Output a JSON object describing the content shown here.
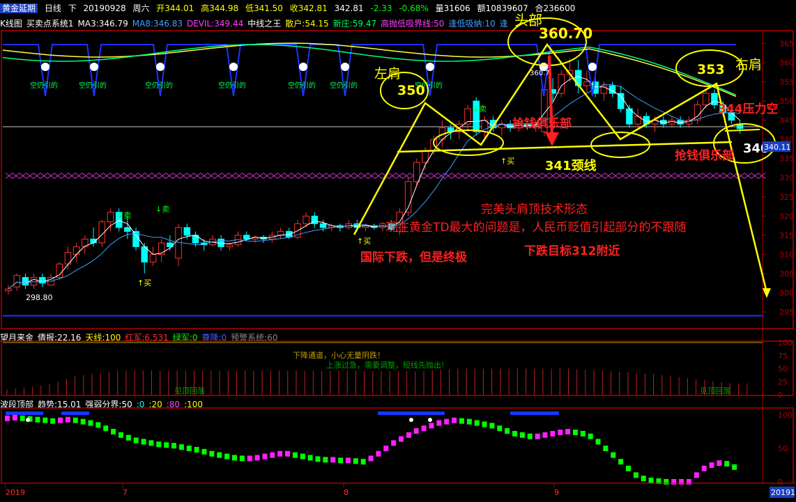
{
  "header": {
    "symbol": "黄金延期",
    "period": "日线",
    "flag": "下",
    "date": "20190928",
    "weekday": "周六",
    "open": "开344.01",
    "high": "高344.98",
    "low": "低341.50",
    "close": "收342.81",
    "last": "342.81",
    "change": "-2.33",
    "change_pct": "-0.68%",
    "volume": "量31606",
    "amount": "额10839607",
    "open_interest": "合236600"
  },
  "indicators_main": [
    {
      "text": "K线图",
      "color": "#ffffff"
    },
    {
      "text": "买卖点系统1",
      "color": "#ffffff"
    },
    {
      "text": "MA3:346.79",
      "color": "#ffffff"
    },
    {
      "text": "MA8:346.83",
      "color": "#3ea0ff"
    },
    {
      "text": "DEVIL:349.44",
      "color": "#ff40ff"
    },
    {
      "text": "中线之王",
      "color": "#ffffff"
    },
    {
      "text": "散户:54.15",
      "color": "#ffff00"
    },
    {
      "text": "新庄:59.47",
      "color": "#00ff60"
    },
    {
      "text": "高抛低吸界线:50",
      "color": "#ff40ff"
    },
    {
      "text": "逢低吸纳:10",
      "color": "#40a0ff"
    },
    {
      "text": "逢",
      "color": "#40a0ff"
    }
  ],
  "indicators_p2": [
    {
      "text": "望月来金",
      "color": "#ffffff"
    },
    {
      "text": "倩报:22.16",
      "color": "#ffffff"
    },
    {
      "text": "天线:100",
      "color": "#ffff00"
    },
    {
      "text": "红军:6.531",
      "color": "#ff3030"
    },
    {
      "text": "绿军:0",
      "color": "#00ff00"
    },
    {
      "text": "尊降:0",
      "color": "#4060ff"
    },
    {
      "text": "预警系统:60",
      "color": "#888888"
    }
  ],
  "indicators_p3": [
    {
      "text": "波段顶部",
      "color": "#ffffff"
    },
    {
      "text": "趋势:15.01",
      "color": "#ffffff"
    },
    {
      "text": "强弱分界:50",
      "color": "#ffffff"
    },
    {
      "text": ":0",
      "color": "#00ffff"
    },
    {
      "text": ":20",
      "color": "#ffff00"
    },
    {
      "text": ":80",
      "color": "#ff40ff"
    },
    {
      "text": ":100",
      "color": "#ffff00"
    }
  ],
  "annotations": {
    "head": "头部",
    "head_value": "360.70",
    "left_shoulder": "左肩",
    "left_value": "350",
    "right_shoulder": "右肩",
    "right_value": "353",
    "neckline": "341颈线",
    "pattern": "完美头肩顶技术形态",
    "problem": "现在黄金TD最大的问题是，人民币贬值引起部分的不跟随",
    "intl": "国际下跌，但是终极",
    "target": "下跌目标312附近",
    "pressure": "344压力空",
    "club1": "抢钱俱乐部",
    "club2": "抢钱俱乐部",
    "v340": "340",
    "v298": "298.80",
    "v360_small": "360.7",
    "buy": "↑买",
    "sell": "↓卖",
    "empty": "空仍引的",
    "p2_down": "下降通道，小心无量阴跌！",
    "p2_mid": "上涨过急，需要调整，短线先抛出!",
    "p2_peak": "见顶回落"
  },
  "price_tag": "340.11",
  "colors": {
    "up": "#ff3030",
    "down": "#00ffff",
    "ma3": "#ffffff",
    "ma8": "#3ea0ff",
    "annotation_yellow": "#ffff00",
    "annotation_red": "#ff2020",
    "blue_band": "#1a35ff"
  },
  "chart_data": [
    {
      "type": "candlestick",
      "y_axis_ticks": [
        295,
        300,
        305,
        310,
        315,
        320,
        325,
        330,
        335,
        340,
        345,
        350,
        355,
        360,
        365
      ],
      "ylim": [
        291,
        368
      ],
      "x_ticks": [
        "2019",
        "7",
        "8",
        "9",
        "20191"
      ],
      "candles": [
        {
          "o": 300.5,
          "h": 302,
          "l": 299.5,
          "c": 301
        },
        {
          "o": 301.5,
          "h": 305,
          "l": 300.5,
          "c": 304.5
        },
        {
          "o": 304,
          "h": 305,
          "l": 301,
          "c": 302
        },
        {
          "o": 302,
          "h": 305,
          "l": 301,
          "c": 304
        },
        {
          "o": 304,
          "h": 305,
          "l": 301.5,
          "c": 302.5
        },
        {
          "o": 302,
          "h": 305,
          "l": 302,
          "c": 304
        },
        {
          "o": 304,
          "h": 308,
          "l": 303.5,
          "c": 307.5
        },
        {
          "o": 307.5,
          "h": 312,
          "l": 306,
          "c": 310.5
        },
        {
          "o": 310,
          "h": 313,
          "l": 308,
          "c": 312
        },
        {
          "o": 312,
          "h": 315,
          "l": 310,
          "c": 314
        },
        {
          "o": 314,
          "h": 317,
          "l": 312,
          "c": 313
        },
        {
          "o": 313,
          "h": 319,
          "l": 312,
          "c": 318.5
        },
        {
          "o": 318.5,
          "h": 322,
          "l": 316,
          "c": 321
        },
        {
          "o": 321,
          "h": 322,
          "l": 316,
          "c": 317
        },
        {
          "o": 317,
          "h": 320,
          "l": 314,
          "c": 316
        },
        {
          "o": 316,
          "h": 317,
          "l": 311,
          "c": 312
        },
        {
          "o": 312,
          "h": 313,
          "l": 305,
          "c": 308
        },
        {
          "o": 308,
          "h": 312,
          "l": 307,
          "c": 310
        },
        {
          "o": 310,
          "h": 314,
          "l": 308,
          "c": 313
        },
        {
          "o": 313,
          "h": 315,
          "l": 311,
          "c": 312
        },
        {
          "o": 309,
          "h": 318,
          "l": 307,
          "c": 317
        },
        {
          "o": 317,
          "h": 318,
          "l": 314,
          "c": 315
        },
        {
          "o": 315,
          "h": 316,
          "l": 312,
          "c": 313
        },
        {
          "o": 313,
          "h": 314,
          "l": 311,
          "c": 312.5
        },
        {
          "o": 312.5,
          "h": 315,
          "l": 312,
          "c": 314
        },
        {
          "o": 314,
          "h": 315,
          "l": 311,
          "c": 312
        },
        {
          "o": 312,
          "h": 313,
          "l": 311,
          "c": 312.5
        },
        {
          "o": 312.5,
          "h": 316,
          "l": 312,
          "c": 315
        },
        {
          "o": 315,
          "h": 316,
          "l": 313.5,
          "c": 314
        },
        {
          "o": 314,
          "h": 315,
          "l": 313,
          "c": 314.5
        },
        {
          "o": 314.5,
          "h": 315,
          "l": 313,
          "c": 314
        },
        {
          "o": 314,
          "h": 316,
          "l": 313,
          "c": 315
        },
        {
          "o": 315,
          "h": 317,
          "l": 314,
          "c": 316
        },
        {
          "o": 316,
          "h": 317,
          "l": 314,
          "c": 314.5
        },
        {
          "o": 314.5,
          "h": 319,
          "l": 314,
          "c": 318
        },
        {
          "o": 318,
          "h": 321,
          "l": 317,
          "c": 320
        },
        {
          "o": 320,
          "h": 321,
          "l": 317,
          "c": 318
        },
        {
          "o": 318,
          "h": 319,
          "l": 316,
          "c": 317
        },
        {
          "o": 317,
          "h": 318,
          "l": 316,
          "c": 317.5
        },
        {
          "o": 317.5,
          "h": 318,
          "l": 316,
          "c": 317
        },
        {
          "o": 317,
          "h": 319,
          "l": 316.5,
          "c": 318
        },
        {
          "o": 318,
          "h": 319,
          "l": 316,
          "c": 317
        },
        {
          "o": 317,
          "h": 318,
          "l": 316,
          "c": 317.5
        },
        {
          "o": 317.5,
          "h": 318,
          "l": 316.5,
          "c": 317
        },
        {
          "o": 317,
          "h": 318.5,
          "l": 316,
          "c": 318
        },
        {
          "o": 318,
          "h": 319,
          "l": 316,
          "c": 316.5
        },
        {
          "o": 316,
          "h": 322,
          "l": 315,
          "c": 321
        },
        {
          "o": 321,
          "h": 330,
          "l": 320,
          "c": 329
        },
        {
          "o": 329,
          "h": 335,
          "l": 328,
          "c": 334
        },
        {
          "o": 334,
          "h": 338,
          "l": 332,
          "c": 337
        },
        {
          "o": 337,
          "h": 341,
          "l": 336,
          "c": 340
        },
        {
          "o": 340,
          "h": 345,
          "l": 338,
          "c": 343
        },
        {
          "o": 343,
          "h": 344,
          "l": 340,
          "c": 342
        },
        {
          "o": 342,
          "h": 345,
          "l": 340,
          "c": 344
        },
        {
          "o": 344,
          "h": 349,
          "l": 342,
          "c": 348
        },
        {
          "o": 350,
          "h": 351,
          "l": 341,
          "c": 342
        },
        {
          "o": 342,
          "h": 346,
          "l": 340,
          "c": 345
        },
        {
          "o": 345,
          "h": 346,
          "l": 342,
          "c": 343
        },
        {
          "o": 343,
          "h": 345,
          "l": 341,
          "c": 344
        },
        {
          "o": 344,
          "h": 345,
          "l": 342,
          "c": 343
        },
        {
          "o": 343,
          "h": 345,
          "l": 342,
          "c": 344
        },
        {
          "o": 344,
          "h": 345,
          "l": 342.5,
          "c": 343.5
        },
        {
          "o": 343.5,
          "h": 345,
          "l": 342,
          "c": 344
        },
        {
          "o": 342,
          "h": 354,
          "l": 341,
          "c": 353
        },
        {
          "o": 353,
          "h": 356,
          "l": 350,
          "c": 352
        },
        {
          "o": 352,
          "h": 358,
          "l": 351,
          "c": 357
        },
        {
          "o": 357,
          "h": 361,
          "l": 355,
          "c": 358
        },
        {
          "o": 358,
          "h": 360.7,
          "l": 352,
          "c": 354
        },
        {
          "o": 354,
          "h": 358,
          "l": 352,
          "c": 355
        },
        {
          "o": 355,
          "h": 357,
          "l": 351,
          "c": 352
        },
        {
          "o": 352,
          "h": 355,
          "l": 350,
          "c": 354
        },
        {
          "o": 354,
          "h": 355,
          "l": 351,
          "c": 352
        },
        {
          "o": 352,
          "h": 354,
          "l": 347,
          "c": 348
        },
        {
          "o": 348,
          "h": 349,
          "l": 343,
          "c": 344
        },
        {
          "o": 344,
          "h": 348,
          "l": 343,
          "c": 346
        },
        {
          "o": 346,
          "h": 347,
          "l": 343,
          "c": 344
        },
        {
          "o": 344,
          "h": 346,
          "l": 342,
          "c": 345
        },
        {
          "o": 345,
          "h": 346,
          "l": 343,
          "c": 344
        },
        {
          "o": 344,
          "h": 346,
          "l": 343,
          "c": 345
        },
        {
          "o": 345,
          "h": 346,
          "l": 343,
          "c": 344
        },
        {
          "o": 344,
          "h": 346,
          "l": 343,
          "c": 345
        },
        {
          "o": 345,
          "h": 350,
          "l": 344,
          "c": 349
        },
        {
          "o": 349,
          "h": 353,
          "l": 348,
          "c": 352
        },
        {
          "o": 352,
          "h": 353,
          "l": 348,
          "c": 349
        },
        {
          "o": 349,
          "h": 350,
          "l": 346,
          "c": 347
        },
        {
          "o": 347,
          "h": 348,
          "l": 344,
          "c": 345
        },
        {
          "o": 344.01,
          "h": 344.98,
          "l": 341.5,
          "c": 342.81
        }
      ],
      "neckline": 341,
      "target": 312
    },
    {
      "type": "bar",
      "name": "望月来金",
      "ylim": [
        0,
        100
      ],
      "y_axis_ticks": [
        0,
        25,
        50,
        75,
        100
      ],
      "values": [
        10,
        12,
        14,
        15,
        18,
        20,
        25,
        30,
        35,
        38,
        40,
        42,
        44,
        45,
        46,
        47,
        47,
        47,
        46,
        46,
        46,
        46,
        46,
        46,
        46,
        46,
        46,
        46,
        46,
        46,
        46,
        46,
        46,
        46,
        46,
        46,
        46,
        46,
        46,
        46,
        46,
        46,
        46,
        45,
        45,
        45,
        45,
        45,
        45,
        46,
        47,
        48,
        49,
        50,
        50,
        50,
        50,
        50,
        50,
        50,
        50,
        50,
        50,
        50,
        50,
        50,
        50,
        49,
        48,
        47,
        46,
        45,
        44,
        43,
        42,
        41,
        40,
        38,
        36,
        34,
        32,
        30,
        28,
        26,
        24,
        22,
        22,
        22
      ]
    },
    {
      "type": "bar",
      "name": "波段顶部",
      "ylim": [
        0,
        100
      ],
      "y_axis_ticks": [
        0,
        50,
        100
      ],
      "values": [
        95,
        96,
        95,
        94,
        93,
        92,
        91,
        92,
        93,
        92,
        90,
        88,
        85,
        80,
        75,
        70,
        66,
        62,
        60,
        58,
        56,
        55,
        54,
        52,
        50,
        48,
        45,
        42,
        40,
        38,
        36,
        35,
        35,
        36,
        38,
        40,
        42,
        42,
        40,
        38,
        36,
        34,
        33,
        33,
        32,
        32,
        31,
        30,
        35,
        42,
        50,
        58,
        64,
        70,
        76,
        80,
        84,
        88,
        90,
        92,
        91,
        90,
        88,
        86,
        84,
        80,
        76,
        72,
        70,
        68,
        68,
        70,
        72,
        74,
        75,
        74,
        72,
        68,
        60,
        50,
        40,
        30,
        20,
        10,
        5,
        2,
        1,
        0,
        0,
        0,
        0,
        10,
        20,
        25,
        28,
        27,
        22
      ]
    }
  ]
}
